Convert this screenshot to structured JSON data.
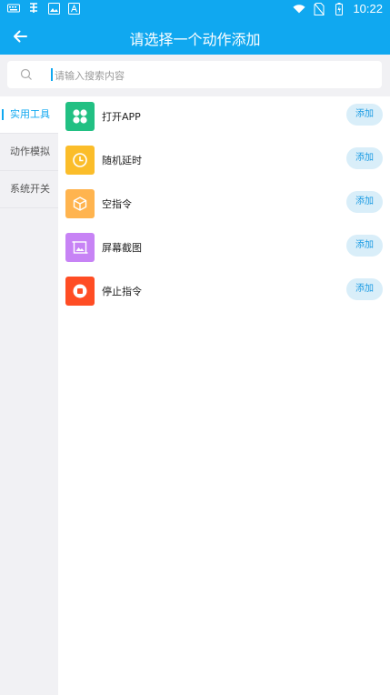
{
  "status_bar": {
    "time": "10:22",
    "left_icons": [
      "keyboard-icon",
      "bug-icon",
      "image-icon",
      "a-box-icon"
    ],
    "right_icons": [
      "wifi-icon",
      "no-sim-icon",
      "battery-icon"
    ]
  },
  "appbar": {
    "title": "请选择一个动作添加",
    "back_icon": "arrow-left-icon"
  },
  "search": {
    "placeholder": "请输入搜索内容"
  },
  "sidebar": {
    "items": [
      {
        "label": "实用工具",
        "active": true
      },
      {
        "label": "动作模拟",
        "active": false
      },
      {
        "label": "系统开关",
        "active": false
      }
    ]
  },
  "actions": [
    {
      "label": "打开APP",
      "icon": "app-grid-icon",
      "color": "#22c083",
      "button": "添加"
    },
    {
      "label": "随机延时",
      "icon": "clock-icon",
      "color": "#fbbd2a",
      "button": "添加"
    },
    {
      "label": "空指令",
      "icon": "cube-icon",
      "color": "#ffb44f",
      "button": "添加"
    },
    {
      "label": "屏幕截图",
      "icon": "screenshot-icon",
      "color": "#c783f5",
      "button": "添加"
    },
    {
      "label": "停止指令",
      "icon": "stop-icon",
      "color": "#ff4d24",
      "button": "添加"
    }
  ],
  "colors": {
    "primary": "#10a8f0",
    "button_bg": "#d9eef9",
    "button_text": "#1a9be3"
  }
}
